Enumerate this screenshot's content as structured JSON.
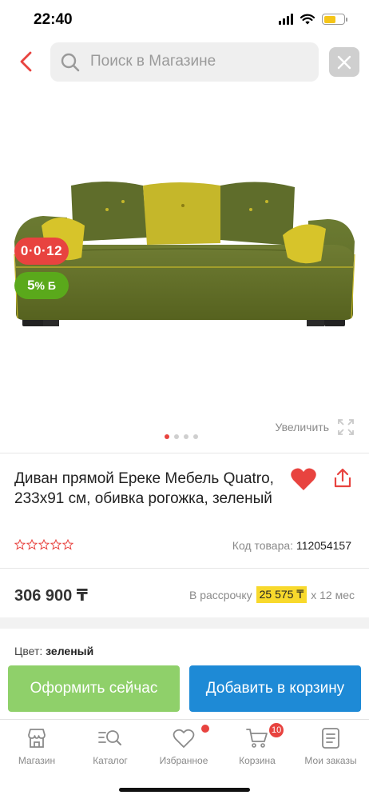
{
  "status_bar": {
    "time": "22:40"
  },
  "search": {
    "placeholder": "Поиск в Магазине"
  },
  "gallery": {
    "badge_installment": "0·0·12",
    "badge_bonus_value": "5",
    "badge_bonus_unit": "% Б",
    "zoom_label": "Увеличить",
    "dots_total": 4,
    "active_dot": 1
  },
  "product": {
    "title": "Диван прямой Ереке Мебель Quatro, 233x91 см, обивка рогожка, зеленый",
    "rating_stars": 0,
    "rating_max": 5,
    "code_label": "Код товара:",
    "code_value": "112054157"
  },
  "price": {
    "value": "306 900 ₸",
    "installment_prefix": "В рассрочку",
    "installment_amount": "25 575 ₸",
    "installment_suffix": "x 12 мес"
  },
  "color": {
    "label": "Цвет:",
    "value": "зеленый"
  },
  "actions": {
    "checkout_label": "Оформить сейчас",
    "add_to_cart_label": "Добавить в корзину"
  },
  "tabbar": {
    "items": [
      {
        "label": "Магазин",
        "icon": "store-icon"
      },
      {
        "label": "Каталог",
        "icon": "catalog-icon"
      },
      {
        "label": "Избранное",
        "icon": "heart-icon",
        "notification": true
      },
      {
        "label": "Корзина",
        "icon": "cart-icon",
        "badge": "10"
      },
      {
        "label": "Мои заказы",
        "icon": "orders-icon"
      }
    ]
  },
  "colors": {
    "accent_red": "#e8433f",
    "bonus_green": "#5aa91b",
    "checkout_green": "#8fd06a",
    "cart_blue": "#1e8ad6",
    "installment_yellow": "#f8d92c"
  }
}
